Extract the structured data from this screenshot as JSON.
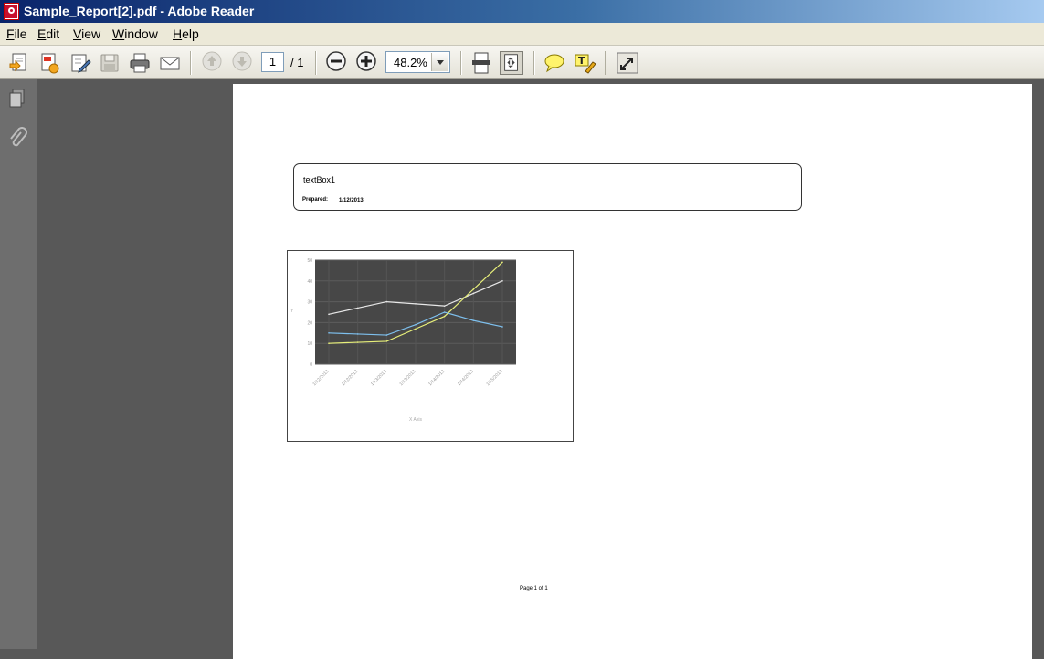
{
  "window": {
    "title": "Sample_Report[2].pdf - Adobe Reader"
  },
  "menu": [
    {
      "label": "File",
      "key": "F"
    },
    {
      "label": "Edit",
      "key": "E"
    },
    {
      "label": "View",
      "key": "V"
    },
    {
      "label": "Window",
      "key": "W"
    },
    {
      "label": "Help",
      "key": "H"
    }
  ],
  "toolbar": {
    "page_current": "1",
    "page_total": "/ 1",
    "zoom": "48.2%",
    "icons": [
      "create-pdf-icon",
      "open-icon",
      "edit-icon",
      "save-icon",
      "print-icon",
      "email-icon",
      "page-up-icon",
      "page-down-icon",
      "zoom-out-icon",
      "zoom-in-icon",
      "fit-width-icon",
      "fit-page-icon",
      "comment-icon",
      "highlight-icon",
      "fullscreen-icon"
    ]
  },
  "sidebar": {
    "icons": [
      "pages-icon",
      "attachments-icon"
    ]
  },
  "document": {
    "header": {
      "textbox": "textBox1",
      "prepared_label": "Prepared:",
      "prepared_date": "1/12/2013"
    },
    "footer": "Page 1 of 1"
  },
  "chart_data": {
    "type": "line",
    "categories": [
      "1/12/2013",
      "1/12/2013",
      "1/13/2013",
      "1/13/2013",
      "1/14/2013",
      "1/14/2013",
      "1/15/2013"
    ],
    "series": [
      {
        "values": [
          24,
          27,
          30,
          29,
          28,
          34,
          40
        ],
        "color": "#e8e8e8"
      },
      {
        "values": [
          15,
          14.5,
          14,
          19,
          25,
          21,
          18
        ],
        "color": "#7ec0ee"
      },
      {
        "values": [
          10,
          10.5,
          11,
          17,
          23,
          36,
          49
        ],
        "color": "#e7ef7a"
      }
    ],
    "ylim": [
      0,
      50
    ],
    "yticks": [
      0,
      10,
      20,
      30,
      40,
      50
    ],
    "xlabel": "X Axis",
    "ylabel": "Y",
    "grid": true,
    "plot_background": "#474747"
  }
}
